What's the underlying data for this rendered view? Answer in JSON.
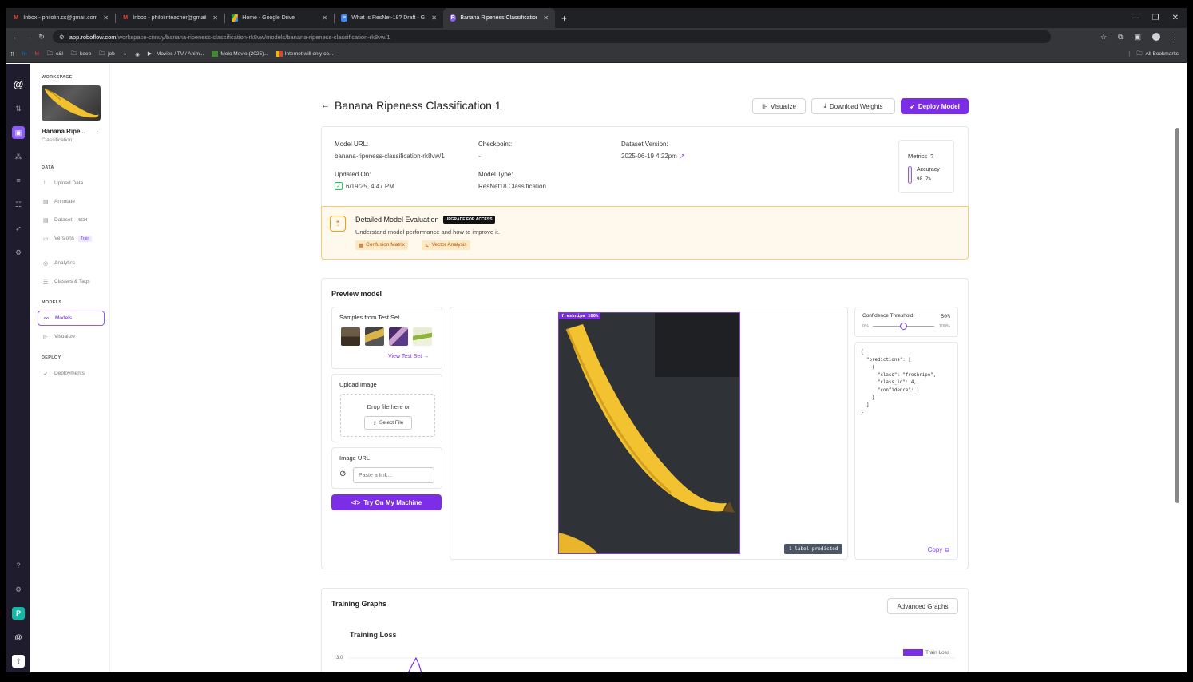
{
  "browser": {
    "tabs": [
      {
        "title": "Inbox - philolin.cs@gmail.com",
        "icon": "gmail-icon"
      },
      {
        "title": "Inbox - philolinteacher@gmail.",
        "icon": "gmail-icon"
      },
      {
        "title": "Home - Google Drive",
        "icon": "drive-icon"
      },
      {
        "title": "What Is ResNet-18? Draft - Goo",
        "icon": "docs-icon"
      },
      {
        "title": "Banana Ripeness Classification",
        "icon": "roboflow-icon"
      }
    ],
    "url_host": "app.roboflow.com",
    "url_path": "/workspace-cnnuy/banana-ripeness-classification-rk8vw/models/banana-ripeness-classification-rk8vw/1",
    "bookmarks": [
      "c&l",
      "keep",
      "job",
      "Movies / TV / Anim...",
      "Melo Movie (2025)...",
      "Internet will only co..."
    ],
    "all_bookmarks": "All Bookmarks"
  },
  "sidebar": {
    "workspace_label": "WORKSPACE",
    "project_name": "Banana Ripe...",
    "project_type": "Classification",
    "sections": {
      "data": "DATA",
      "models": "MODELS",
      "deploy": "DEPLOY"
    },
    "items": {
      "upload": "Upload Data",
      "annotate": "Annotate",
      "dataset": "Dataset",
      "dataset_count": "5634",
      "versions": "Versions",
      "versions_badge": "Train",
      "analytics": "Analytics",
      "classes": "Classes & Tags",
      "models": "Models",
      "visualize": "Visualize",
      "deployments": "Deployments"
    }
  },
  "header": {
    "title": "Banana Ripeness Classification 1",
    "visualize": "Visualize",
    "download": "Download Weights",
    "deploy": "Deploy Model"
  },
  "info": {
    "model_url_label": "Model URL:",
    "model_url": "banana-ripeness-classification-rk8vw/1",
    "checkpoint_label": "Checkpoint:",
    "checkpoint": "-",
    "dataset_version_label": "Dataset Version:",
    "dataset_version": "2025-06-19 4:22pm",
    "updated_label": "Updated On:",
    "updated": "6/19/25, 4:47 PM",
    "model_type_label": "Model Type:",
    "model_type": "ResNet18 Classification",
    "metrics_label": "Metrics",
    "accuracy_label": "Accuracy",
    "accuracy": "98.7%"
  },
  "evaluation": {
    "title": "Detailed Model Evaluation",
    "upgrade": "UPGRADE FOR ACCESS",
    "desc": "Understand model performance and how to improve it.",
    "confusion": "Confusion Matrix",
    "vector": "Vector Analysis"
  },
  "preview": {
    "title": "Preview model",
    "samples_title": "Samples from Test Set",
    "view_test": "View Test Set →",
    "upload_title": "Upload Image",
    "drop": "Drop file here or",
    "select": "Select File",
    "url_title": "Image URL",
    "url_placeholder": "Paste a link...",
    "try": "Try On My Machine",
    "pred_label": "freshripe 100%",
    "labels_predicted": "1 label predicted",
    "threshold_label": "Confidence Threshold:",
    "threshold_value": "50%",
    "threshold_fraction": 0.5,
    "threshold_min": "0%",
    "threshold_max": "100%",
    "json": "{\n  \"predictions\": [\n    {\n      \"class\": \"freshripe\",\n      \"class_id\": 4,\n      \"confidence\": 1\n    }\n  ]\n}",
    "copy": "Copy"
  },
  "training": {
    "title": "Training Graphs",
    "advanced": "Advanced Graphs",
    "loss_title": "Training Loss",
    "legend": "Train Loss",
    "y_top": "3.0"
  },
  "colors": {
    "accent": "#7c2ee6",
    "banner_bg": "#fff8ec",
    "banner_border": "#f5c97a",
    "rail": "#1f1c2e"
  }
}
